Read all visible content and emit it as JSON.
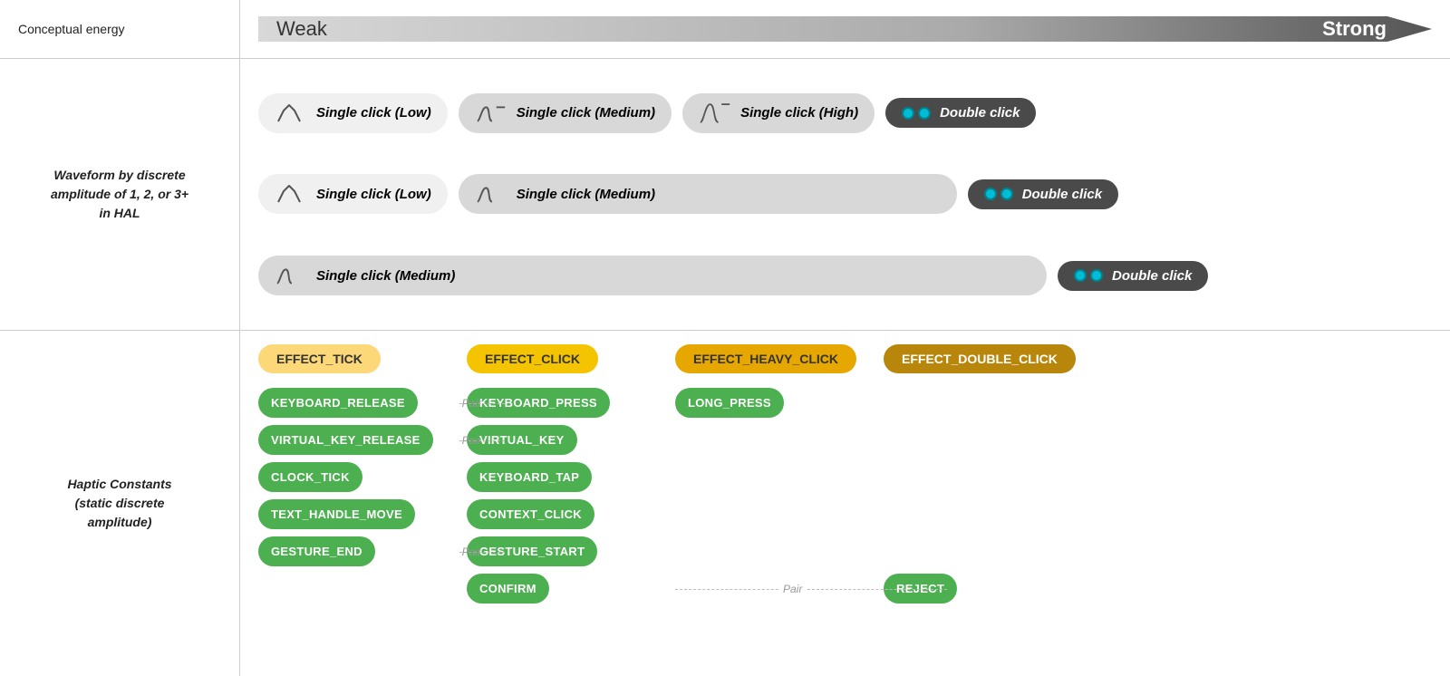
{
  "conceptual_energy": {
    "label": "Conceptual energy",
    "weak": "Weak",
    "strong": "Strong"
  },
  "waveform_label": "Waveform by discrete\namplitude of 1, 2, or 3+\nin HAL",
  "haptic_label": "Haptic Constants\n(static discrete\namplitude)",
  "rows": [
    {
      "pills": [
        {
          "type": "light",
          "icon": "low",
          "text": "Single click (Low)"
        },
        {
          "type": "medium",
          "icon": "med",
          "text": "Single click (Medium)"
        },
        {
          "type": "medium",
          "icon": "high",
          "text": "Single click (High)"
        },
        {
          "type": "dark",
          "icon": "double",
          "text": "Double click"
        }
      ]
    },
    {
      "pills": [
        {
          "type": "light",
          "icon": "low",
          "text": "Single click (Low)"
        },
        {
          "type": "medium",
          "icon": "med",
          "text": "Single click (Medium)"
        },
        {
          "type": "none"
        },
        {
          "type": "dark",
          "icon": "double",
          "text": "Double click"
        }
      ]
    },
    {
      "pills": [
        {
          "type": "none"
        },
        {
          "type": "medium",
          "icon": "med",
          "text": "Single click (Medium)"
        },
        {
          "type": "none"
        },
        {
          "type": "dark",
          "icon": "double",
          "text": "Double click"
        }
      ]
    }
  ],
  "effects": [
    {
      "label": "EFFECT_TICK",
      "style": "light"
    },
    {
      "label": "EFFECT_CLICK",
      "style": "mid"
    },
    {
      "label": "EFFECT_HEAVY_CLICK",
      "style": "heavy"
    },
    {
      "label": "EFFECT_DOUBLE_CLICK",
      "style": "double"
    }
  ],
  "constants": {
    "col0": [
      "KEYBOARD_RELEASE",
      "VIRTUAL_KEY_RELEASE",
      "CLOCK_TICK",
      "TEXT_HANDLE_MOVE",
      "GESTURE_END"
    ],
    "col1": [
      "KEYBOARD_PRESS",
      "VIRTUAL_KEY",
      "KEYBOARD_TAP",
      "CONTEXT_CLICK",
      "GESTURE_START",
      "CONFIRM"
    ],
    "col2": [
      "LONG_PRESS"
    ],
    "col3": [
      "REJECT"
    ],
    "pairs": [
      {
        "from": "KEYBOARD_RELEASE",
        "to": "KEYBOARD_PRESS",
        "label": "Pair"
      },
      {
        "from": "VIRTUAL_KEY_RELEASE",
        "to": "VIRTUAL_KEY",
        "label": "Pair"
      },
      {
        "from": "GESTURE_END",
        "to": "GESTURE_START",
        "label": "Pair"
      },
      {
        "from": "CONFIRM",
        "to": "REJECT",
        "label": "Pair"
      }
    ]
  }
}
